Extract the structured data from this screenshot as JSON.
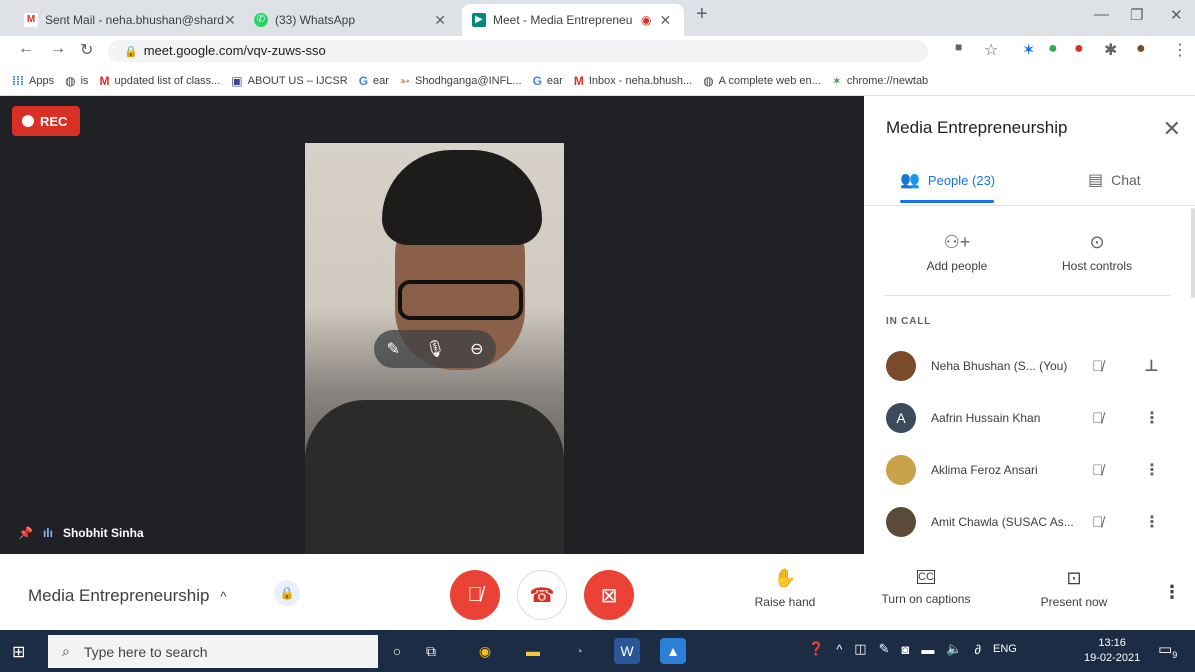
{
  "browser": {
    "tabs": [
      {
        "label": "Sent Mail - neha.bhushan@shard",
        "icon": "gmail-icon"
      },
      {
        "label": "(33) WhatsApp",
        "icon": "whatsapp-icon"
      },
      {
        "label": "Meet - Media Entrepreneurs",
        "icon": "meet-icon"
      }
    ],
    "url": "meet.google.com/vqv-zuws-sso",
    "bookmarks": [
      "Apps",
      "is",
      "updated list of class...",
      "ABOUT US – IJCSR",
      "ear",
      "Shodhganga@INFL...",
      "ear",
      "Inbox - neha.bhush...",
      "A complete web en...",
      "chrome://newtab"
    ]
  },
  "meet": {
    "rec_label": "REC",
    "speaker": "Shobhit Sinha",
    "panel_title": "Media Entrepreneurship",
    "people_tab": "People (23)",
    "chat_tab": "Chat",
    "add_people": "Add people",
    "host_controls": "Host controls",
    "in_call": "IN CALL",
    "participants": [
      {
        "name": "Neha Bhushan (S...",
        "suffix": "(You)",
        "initial": "",
        "color": "#7b4a2a"
      },
      {
        "name": "Aafrin Hussain Khan",
        "suffix": "",
        "initial": "A",
        "color": "#3c4a5c"
      },
      {
        "name": "Aklima Feroz Ansari",
        "suffix": "",
        "initial": "",
        "color": "#c9a24a"
      },
      {
        "name": "Amit Chawla (SUSAC As...",
        "suffix": "",
        "initial": "",
        "color": "#5a4a3a"
      }
    ],
    "meeting_name": "Media Entrepreneurship",
    "raise_hand": "Raise hand",
    "captions": "Turn on captions",
    "present": "Present now"
  },
  "taskbar": {
    "search_placeholder": "Type here to search",
    "lang": "ENG",
    "time": "13:16",
    "date": "19-02-2021",
    "notif_count": "9"
  }
}
